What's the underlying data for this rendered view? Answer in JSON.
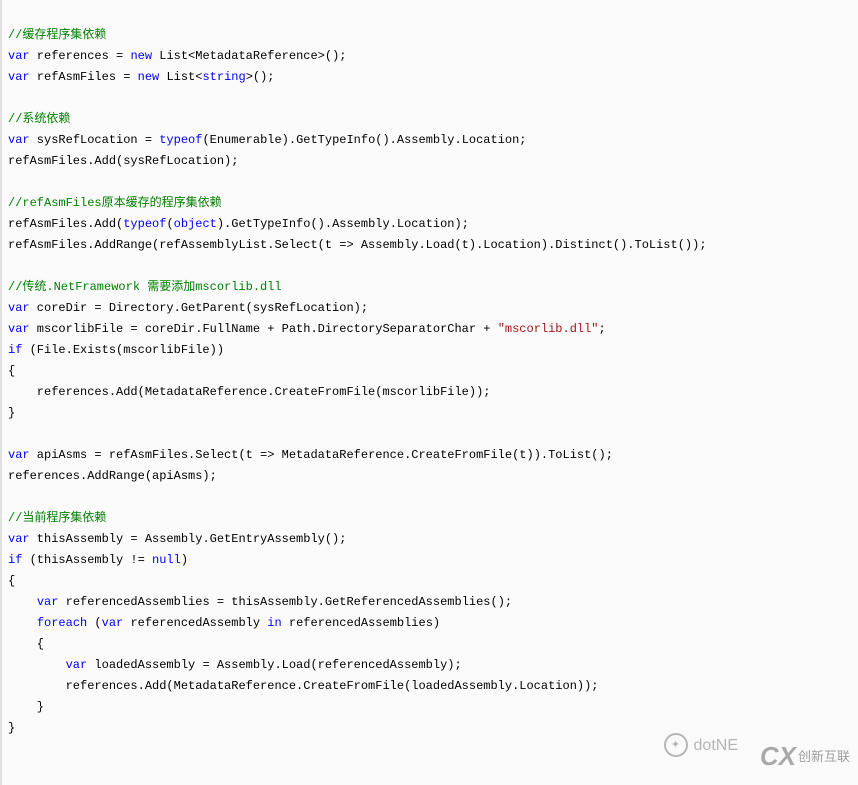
{
  "code": {
    "c1": "//缓存程序集依赖",
    "l2a": "var",
    "l2b": " references = ",
    "l2c": "new",
    "l2d": " List<MetadataReference>();",
    "l3a": "var",
    "l3b": " refAsmFiles = ",
    "l3c": "new",
    "l3d": " List<",
    "l3e": "string",
    "l3f": ">();",
    "c2": "//系统依赖",
    "l5a": "var",
    "l5b": " sysRefLocation = ",
    "l5c": "typeof",
    "l5d": "(Enumerable).GetTypeInfo().Assembly.Location;",
    "l6": "refAsmFiles.Add(sysRefLocation);",
    "c3": "//refAsmFiles原本缓存的程序集依赖",
    "l8a": "refAsmFiles.Add(",
    "l8b": "typeof",
    "l8c": "(",
    "l8d": "object",
    "l8e": ").GetTypeInfo().Assembly.Location);",
    "l9": "refAsmFiles.AddRange(refAssemblyList.Select(t => Assembly.Load(t).Location).Distinct().ToList());",
    "c4": "//传统.NetFramework 需要添加mscorlib.dll",
    "l11a": "var",
    "l11b": " coreDir = Directory.GetParent(sysRefLocation);",
    "l12a": "var",
    "l12b": " mscorlibFile = coreDir.FullName + Path.DirectorySeparatorChar + ",
    "l12c": "\"mscorlib.dll\"",
    "l12d": ";",
    "l13a": "if",
    "l13b": " (File.Exists(mscorlibFile))",
    "l14": "{",
    "l15": "    references.Add(MetadataReference.CreateFromFile(mscorlibFile));",
    "l16": "}",
    "l18a": "var",
    "l18b": " apiAsms = refAsmFiles.Select(t => MetadataReference.CreateFromFile(t)).ToList();",
    "l19": "references.AddRange(apiAsms);",
    "c5": "//当前程序集依赖",
    "l21a": "var",
    "l21b": " thisAssembly = Assembly.GetEntryAssembly();",
    "l22a": "if",
    "l22b": " (thisAssembly != ",
    "l22c": "null",
    "l22d": ")",
    "l23": "{",
    "l24a": "    ",
    "l24b": "var",
    "l24c": " referencedAssemblies = thisAssembly.GetReferencedAssemblies();",
    "l25a": "    ",
    "l25b": "foreach",
    "l25c": " (",
    "l25d": "var",
    "l25e": " referencedAssembly ",
    "l25f": "in",
    "l25g": " referencedAssemblies)",
    "l26": "    {",
    "l27a": "        ",
    "l27b": "var",
    "l27c": " loadedAssembly = Assembly.Load(referencedAssembly);",
    "l28": "        references.Add(MetadataReference.CreateFromFile(loadedAssembly.Location));",
    "l29": "    }",
    "l30": "}"
  },
  "watermark1": "dotNE",
  "watermark2": "创新互联"
}
